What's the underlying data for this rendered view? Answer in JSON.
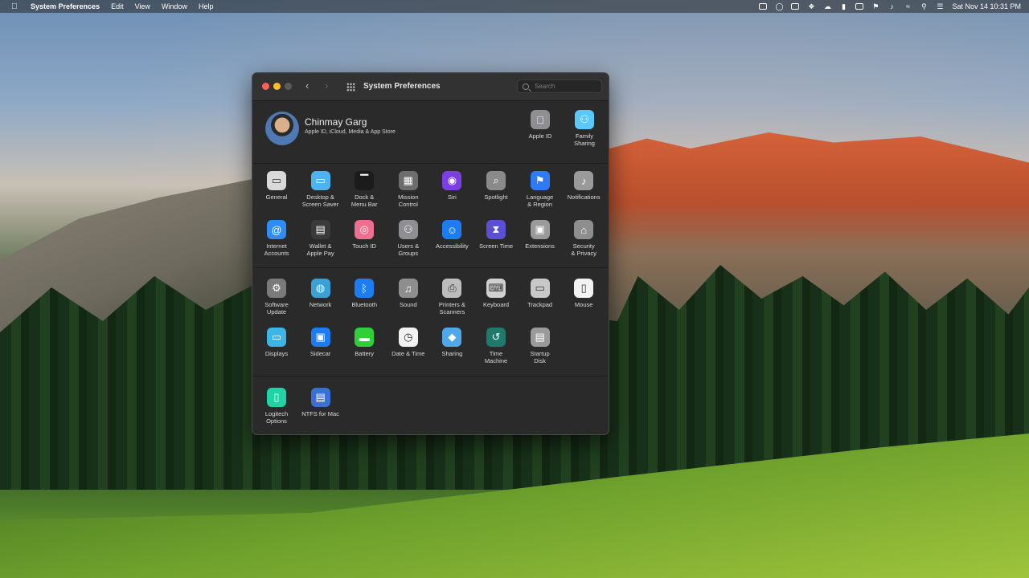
{
  "menubar": {
    "app": "System Preferences",
    "items": [
      "Edit",
      "View",
      "Window",
      "Help"
    ],
    "clock": "Sat Nov 14  10:31 PM"
  },
  "window": {
    "title": "System Preferences",
    "search_placeholder": "Search"
  },
  "account": {
    "name": "Chinmay Garg",
    "subtitle": "Apple ID, iCloud, Media & App Store"
  },
  "top_panes": [
    {
      "label": "Apple ID",
      "icon": "apple-icon",
      "color": "#8e8e93"
    },
    {
      "label": "Family\nSharing",
      "icon": "family-icon",
      "color": "#5ac8fa"
    }
  ],
  "row1": [
    {
      "label": "General",
      "icon": "general-icon",
      "color": "#d9d9d9"
    },
    {
      "label": "Desktop &\nScreen Saver",
      "icon": "desktop-icon",
      "color": "#4fb3f0"
    },
    {
      "label": "Dock &\nMenu Bar",
      "icon": "dock-icon",
      "color": "#1b1b1b"
    },
    {
      "label": "Mission\nControl",
      "icon": "mission-control-icon",
      "color": "#6d6d6d"
    },
    {
      "label": "Siri",
      "icon": "siri-icon",
      "color": "#7b3fe4"
    },
    {
      "label": "Spotlight",
      "icon": "spotlight-icon",
      "color": "#8a8a8a"
    },
    {
      "label": "Language\n& Region",
      "icon": "globe-flag-icon",
      "color": "#2f7bf5"
    },
    {
      "label": "Notifications",
      "icon": "bell-icon",
      "color": "#9a9a9a"
    }
  ],
  "row2": [
    {
      "label": "Internet\nAccounts",
      "icon": "at-icon",
      "color": "#2f8cf5"
    },
    {
      "label": "Wallet &\nApple Pay",
      "icon": "wallet-icon",
      "color": "#3a3a3a"
    },
    {
      "label": "Touch ID",
      "icon": "fingerprint-icon",
      "color": "#ef6f8e"
    },
    {
      "label": "Users &\nGroups",
      "icon": "users-icon",
      "color": "#8e8e93"
    },
    {
      "label": "Accessibility",
      "icon": "accessibility-icon",
      "color": "#1d7cf2"
    },
    {
      "label": "Screen Time",
      "icon": "hourglass-icon",
      "color": "#5b4fd6"
    },
    {
      "label": "Extensions",
      "icon": "puzzle-icon",
      "color": "#9a9a9a"
    },
    {
      "label": "Security\n& Privacy",
      "icon": "house-lock-icon",
      "color": "#8e8e8e"
    }
  ],
  "row3": [
    {
      "label": "Software\nUpdate",
      "icon": "gear-icon",
      "color": "#7a7a7a"
    },
    {
      "label": "Network",
      "icon": "network-globe-icon",
      "color": "#3aa0d8"
    },
    {
      "label": "Bluetooth",
      "icon": "bluetooth-icon",
      "color": "#1d7cf2"
    },
    {
      "label": "Sound",
      "icon": "speaker-icon",
      "color": "#8e8e8e"
    },
    {
      "label": "Printers &\nScanners",
      "icon": "printer-icon",
      "color": "#bdbdbd"
    },
    {
      "label": "Keyboard",
      "icon": "keyboard-icon",
      "color": "#d0d0d0"
    },
    {
      "label": "Trackpad",
      "icon": "trackpad-icon",
      "color": "#c8c8c8"
    },
    {
      "label": "Mouse",
      "icon": "mouse-icon",
      "color": "#f2f2f2"
    }
  ],
  "row4": [
    {
      "label": "Displays",
      "icon": "display-icon",
      "color": "#3cb6e8"
    },
    {
      "label": "Sidecar",
      "icon": "sidecar-icon",
      "color": "#1d7cf2"
    },
    {
      "label": "Battery",
      "icon": "battery-icon",
      "color": "#2fcf3a"
    },
    {
      "label": "Date & Time",
      "icon": "clock-icon",
      "color": "#f2f2f2"
    },
    {
      "label": "Sharing",
      "icon": "sharing-folder-icon",
      "color": "#4fa9e8"
    },
    {
      "label": "Time\nMachine",
      "icon": "time-machine-icon",
      "color": "#1e7a6a"
    },
    {
      "label": "Startup\nDisk",
      "icon": "disk-icon",
      "color": "#9a9a9a"
    }
  ],
  "row5": [
    {
      "label": "Logitech Options",
      "icon": "logitech-mouse-icon",
      "color": "#1fd3a4"
    },
    {
      "label": "NTFS for Mac",
      "icon": "ntfs-icon",
      "color": "#3b6fd8"
    }
  ]
}
